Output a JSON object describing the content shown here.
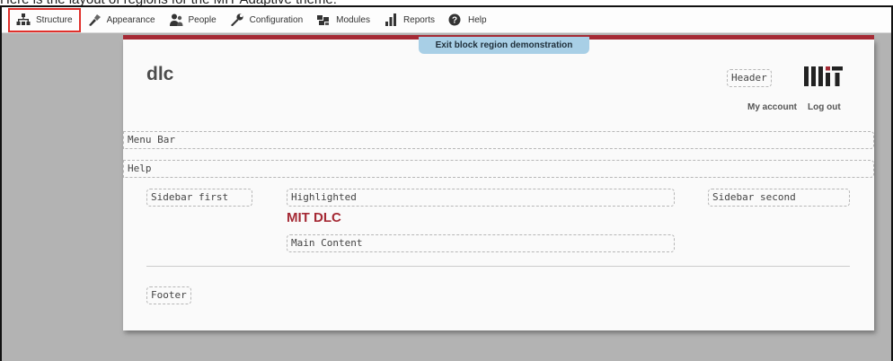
{
  "caption": "Here is the layout of regions for the MIT Adaptive theme:",
  "toolbar": {
    "items": [
      {
        "label": "Structure",
        "icon": "structure-icon"
      },
      {
        "label": "Appearance",
        "icon": "appearance-icon"
      },
      {
        "label": "People",
        "icon": "people-icon"
      },
      {
        "label": "Configuration",
        "icon": "configuration-icon"
      },
      {
        "label": "Modules",
        "icon": "modules-icon"
      },
      {
        "label": "Reports",
        "icon": "reports-icon"
      },
      {
        "label": "Help",
        "icon": "help-icon"
      }
    ],
    "active_item": "Structure",
    "active_outline_color": "#e0302b"
  },
  "exit_button": {
    "label": "Exit block region demonstration"
  },
  "site": {
    "name": "dlc",
    "logo": "MIT"
  },
  "account_links": {
    "my_account": "My account",
    "log_out": "Log out"
  },
  "regions": {
    "header": "Header",
    "menu_bar": "Menu Bar",
    "help": "Help",
    "sidebar_first": "Sidebar first",
    "highlighted": "Highlighted",
    "main_content": "Main Content",
    "sidebar_second": "Sidebar second",
    "footer": "Footer"
  },
  "highlighted_title": "MIT DLC",
  "colors": {
    "accent": "#a52a35",
    "exit_button_bg": "#a8cfe6",
    "backdrop": "#b3b3b3"
  }
}
